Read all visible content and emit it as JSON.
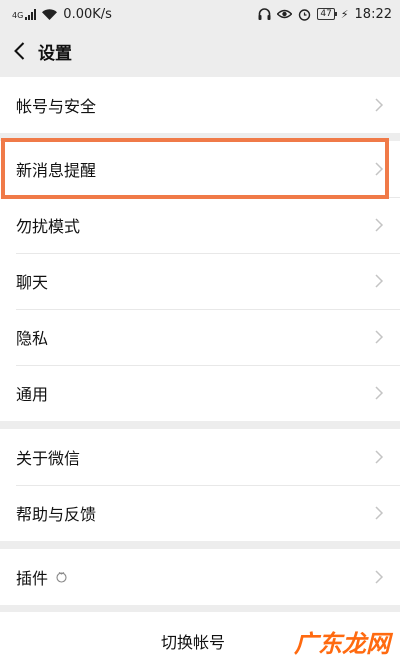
{
  "statusbar": {
    "network": "4G",
    "speed": "0.00K/s",
    "battery": "47",
    "time": "18:22"
  },
  "header": {
    "title": "设置"
  },
  "group1": [
    {
      "label": "帐号与安全"
    }
  ],
  "group2": [
    {
      "label": "新消息提醒"
    },
    {
      "label": "勿扰模式"
    },
    {
      "label": "聊天"
    },
    {
      "label": "隐私"
    },
    {
      "label": "通用"
    }
  ],
  "group3": [
    {
      "label": "关于微信"
    },
    {
      "label": "帮助与反馈"
    }
  ],
  "group4": [
    {
      "label": "插件"
    }
  ],
  "footer": {
    "switch_account": "切换帐号"
  },
  "watermark": "广东龙网",
  "colors": {
    "highlight": "#f07a48",
    "watermark": "#ff6a10",
    "background": "#ededed"
  }
}
